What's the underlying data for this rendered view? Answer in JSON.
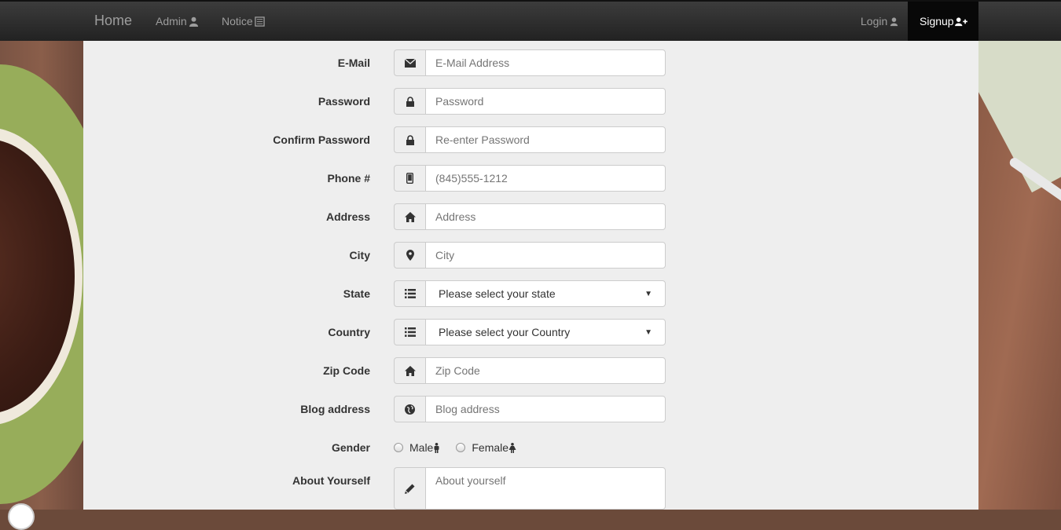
{
  "navbar": {
    "brand": "Home",
    "admin": "Admin",
    "notice": "Notice",
    "login": "Login",
    "signup": "Signup"
  },
  "form": {
    "email": {
      "label": "E-Mail",
      "placeholder": "E-Mail Address",
      "icon": "envelope-icon"
    },
    "password": {
      "label": "Password",
      "placeholder": "Password",
      "icon": "lock-icon"
    },
    "confirm": {
      "label": "Confirm Password",
      "placeholder": "Re-enter Password",
      "icon": "lock-icon"
    },
    "phone": {
      "label": "Phone #",
      "placeholder": "(845)555-1212",
      "icon": "phone-icon"
    },
    "address": {
      "label": "Address",
      "placeholder": "Address",
      "icon": "home-icon"
    },
    "city": {
      "label": "City",
      "placeholder": "City",
      "icon": "map-marker-icon"
    },
    "state": {
      "label": "State",
      "selected": "Please select your state",
      "icon": "list-icon"
    },
    "country": {
      "label": "Country",
      "selected": "Please select your Country",
      "icon": "list-icon"
    },
    "zip": {
      "label": "Zip Code",
      "placeholder": "Zip Code",
      "icon": "home-icon"
    },
    "blog": {
      "label": "Blog address",
      "placeholder": "Blog address",
      "icon": "globe-icon"
    },
    "gender": {
      "label": "Gender",
      "male": "Male",
      "female": "Female"
    },
    "about": {
      "label": "About Yourself",
      "placeholder": "About yourself",
      "icon": "pencil-icon"
    }
  },
  "colors": {
    "navbar": "#222222",
    "panel": "#eeeeee",
    "active_nav": "#080808"
  }
}
